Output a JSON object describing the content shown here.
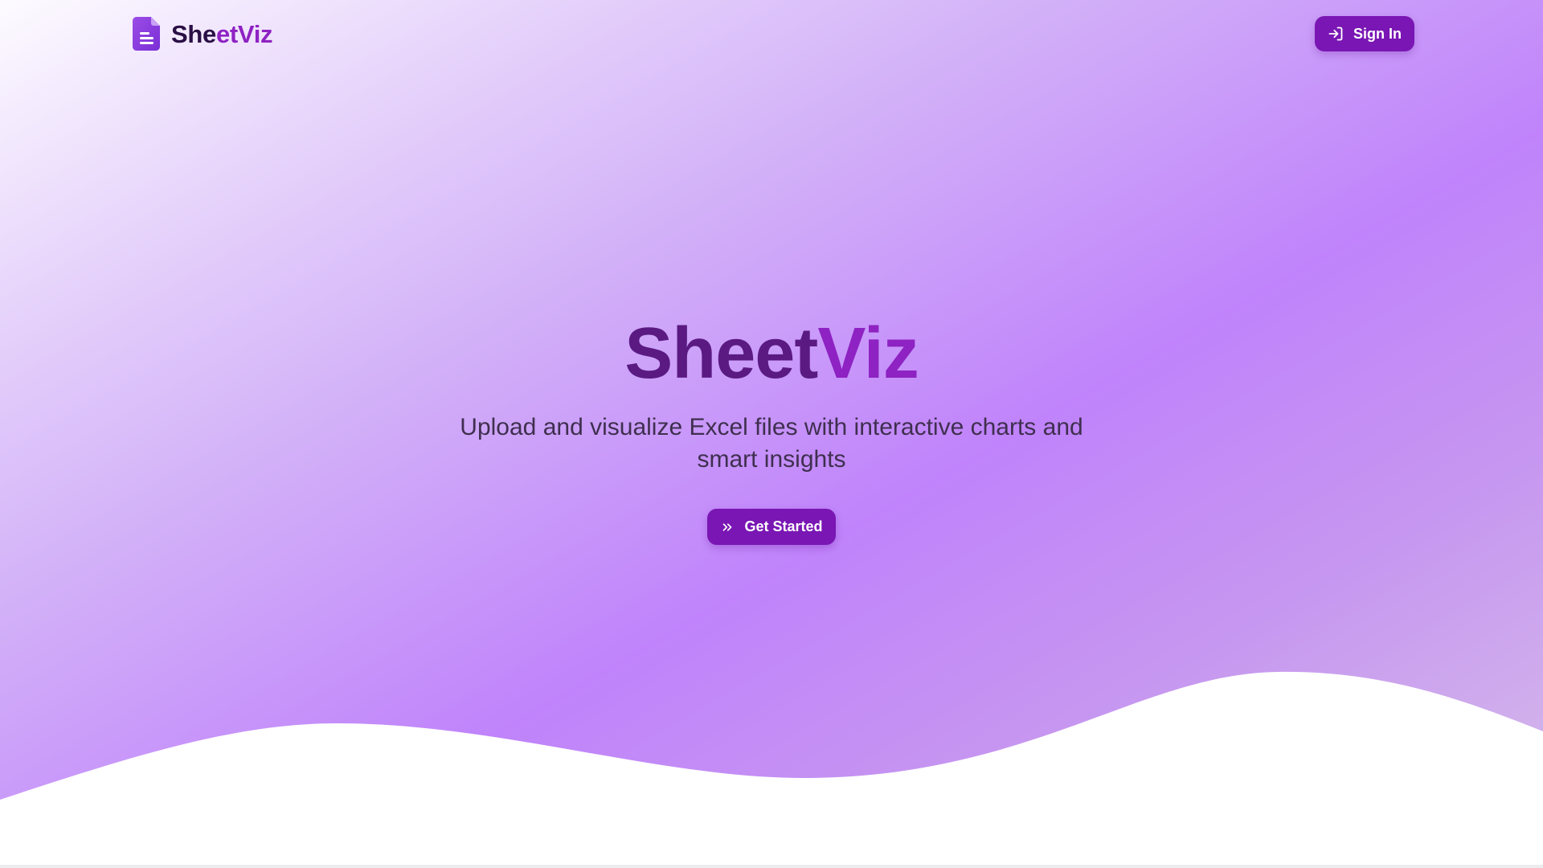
{
  "header": {
    "brand_part1": "She",
    "brand_part2": "etViz",
    "logo_icon": "document-icon",
    "signin_label": "Sign In",
    "signin_icon": "sign-in-icon"
  },
  "hero": {
    "title_part1": "Sheet",
    "title_part2": "Viz",
    "subtitle": "Upload and visualize Excel files with interactive charts and smart insights",
    "cta_label": "Get Started",
    "cta_icon": "double-chevron-right-icon"
  },
  "colors": {
    "primary": "#7a16b4",
    "brand_dark": "#2a0f45",
    "brand_accent": "#8e22c2",
    "title_dark": "#5a1a82",
    "background_light": "#fdfbff",
    "background_mid": "#c083fb",
    "background_end": "#d6bdea"
  }
}
